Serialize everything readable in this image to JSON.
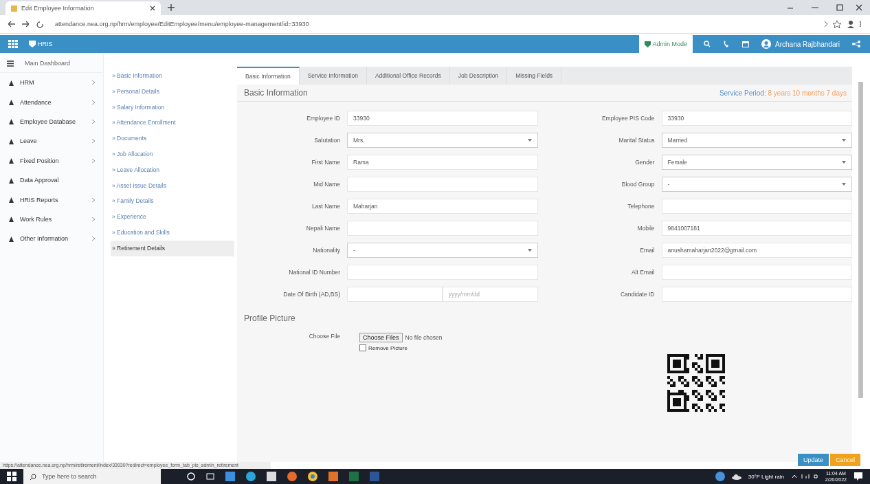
{
  "browser": {
    "tab_title": "Edit Employee Information",
    "url": "attendance.nea.org.np/hrm/employee/EditEmployee/menu/employee-management/id=33930"
  },
  "header": {
    "brand": "HRIS",
    "admin_mode": "Admin Mode",
    "user": "Archana Rajbhandari"
  },
  "sidebar": {
    "dashboard": "Main Dashboard",
    "items": [
      {
        "label": "HRM",
        "expandable": true
      },
      {
        "label": "Attendance",
        "expandable": true
      },
      {
        "label": "Employee Database",
        "expandable": true
      },
      {
        "label": "Leave",
        "expandable": true
      },
      {
        "label": "Fixed Position",
        "expandable": true
      },
      {
        "label": "Data Approval",
        "expandable": false
      },
      {
        "label": "HRIS Reports",
        "expandable": true
      },
      {
        "label": "Work Rules",
        "expandable": true
      },
      {
        "label": "Other Information",
        "expandable": true
      }
    ]
  },
  "subnav": [
    {
      "label": "» Basic Information",
      "selected": false
    },
    {
      "label": "» Personal Details",
      "selected": false
    },
    {
      "label": "» Salary Information",
      "selected": false
    },
    {
      "label": "» Attendance Enrollment",
      "selected": false
    },
    {
      "label": "» Documents",
      "selected": false
    },
    {
      "label": "» Job Allocation",
      "selected": false
    },
    {
      "label": "» Leave Allocation",
      "selected": false
    },
    {
      "label": "» Asset Issue Details",
      "selected": false
    },
    {
      "label": "» Family Details",
      "selected": false
    },
    {
      "label": "» Experience",
      "selected": false
    },
    {
      "label": "» Education and Skills",
      "selected": false
    },
    {
      "label": "» Retirement Details",
      "selected": true
    }
  ],
  "tabs": [
    {
      "label": "Basic Information",
      "selected": true
    },
    {
      "label": "Service Information",
      "selected": false
    },
    {
      "label": "Additional Office Records",
      "selected": false
    },
    {
      "label": "Job Description",
      "selected": false
    },
    {
      "label": "Missing Fields",
      "selected": false
    }
  ],
  "section_title": "Basic Information",
  "service_period": {
    "label": "Service Period:",
    "value": "8 years 10 months 7 days"
  },
  "left_fields": [
    {
      "label": "Employee ID",
      "kind": "text",
      "value": "33930"
    },
    {
      "label": "Salutation",
      "kind": "select",
      "value": "Mrs."
    },
    {
      "label": "First Name",
      "kind": "text",
      "value": "Rama"
    },
    {
      "label": "Mid Name",
      "kind": "text"
    },
    {
      "label": "Last Name",
      "kind": "text",
      "value": "Maharjan"
    },
    {
      "label": "Nepali Name",
      "kind": "text"
    },
    {
      "label": "Nationality",
      "kind": "select",
      "value": "-"
    },
    {
      "label": "National ID Number",
      "kind": "text"
    },
    {
      "label": "Date Of Birth (AD,BS)",
      "kind": "date",
      "placeholder": "yyyy/mm/dd"
    }
  ],
  "right_fields": [
    {
      "label": "Employee PIS Code",
      "kind": "text",
      "value": "33930"
    },
    {
      "label": "Marital Status",
      "kind": "select",
      "value": "Married"
    },
    {
      "label": "Gender",
      "kind": "select",
      "value": "Female"
    },
    {
      "label": "Blood Group",
      "kind": "select",
      "value": "-"
    },
    {
      "label": "Telephone",
      "kind": "text"
    },
    {
      "label": "Mobile",
      "kind": "text",
      "value": "9841007181"
    },
    {
      "label": "Email",
      "kind": "text",
      "value": "anushamaharjan2022@gmail.com"
    },
    {
      "label": "Alt Email",
      "kind": "text"
    },
    {
      "label": "Candidate ID",
      "kind": "text"
    }
  ],
  "profile": {
    "title": "Profile Picture",
    "label": "Choose File",
    "button": "Choose Files",
    "status": "No file chosen",
    "remove": {
      "label": "Remove Picture",
      "checked": false
    }
  },
  "actions": [
    "Update",
    "Cancel"
  ],
  "status_url": "https://attendance.nea.org.np/hrm/retirement/index/33930?redirect=employee_form_tab_pis_admin_retirement",
  "taskbar": {
    "search": "Type here to search",
    "weather": "30°F Light rain",
    "time": "11:04 AM",
    "date": "2/20/2022"
  }
}
